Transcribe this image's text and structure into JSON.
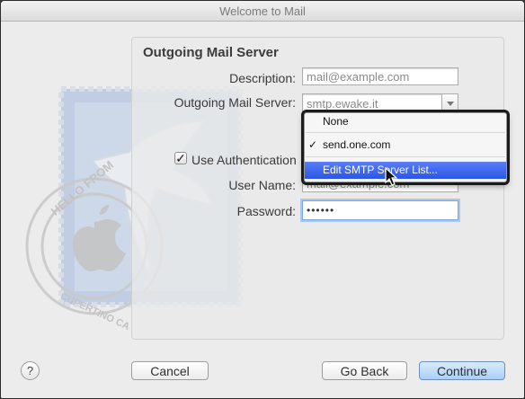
{
  "window": {
    "title": "Welcome to Mail"
  },
  "panel": {
    "title": "Outgoing Mail Server"
  },
  "form": {
    "description_label": "Description:",
    "description_value": "mail@example.com",
    "server_label": "Outgoing Mail Server:",
    "server_value": "smtp.ewake.it",
    "use_auth_label": "Use Authentication",
    "use_auth_checked": true,
    "username_label": "User Name:",
    "username_value": "mail@example.com",
    "password_label": "Password:",
    "password_value": "••••••"
  },
  "server_menu": {
    "items": [
      {
        "label": "None",
        "checked": false
      },
      {
        "label": "send.one.com",
        "checked": true
      },
      {
        "label": "Edit SMTP Server List...",
        "highlighted": true
      }
    ],
    "check_glyph": "✓"
  },
  "buttons": {
    "help": "?",
    "cancel": "Cancel",
    "back": "Go Back",
    "continue": "Continue"
  },
  "stamp_text": {
    "top": "HELLO FROM",
    "bottom": "CUPERTINO CA"
  },
  "colors": {
    "highlight": "#2a56e6",
    "default_button": "#a9cff7",
    "window_bg": "#ececec"
  },
  "icons": {
    "help": "help-icon",
    "checkbox": "checkmark-icon",
    "dropdown": "chevron-down-icon",
    "cursor": "pointer-cursor-icon",
    "stamp": "mail-stamp-icon"
  }
}
